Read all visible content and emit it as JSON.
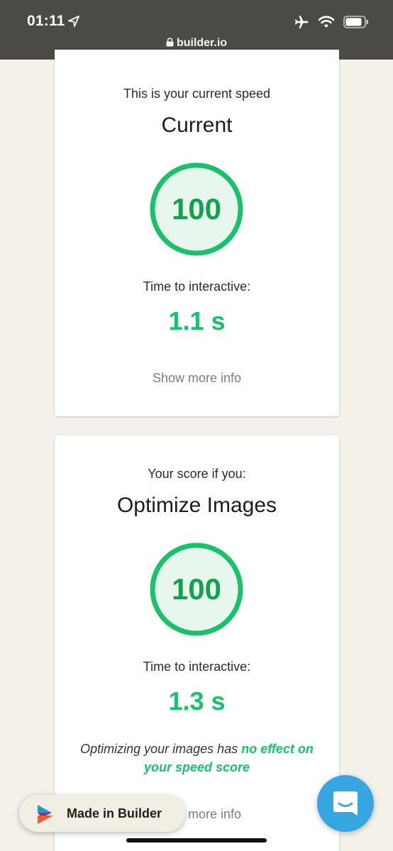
{
  "status_bar": {
    "time": "01:11",
    "url": "builder.io"
  },
  "colors": {
    "score_green": "#19c26a",
    "gauge_fill": "#e8f7ee",
    "chat_blue": "#36a6e0",
    "bar_bg": "#4b4a44"
  },
  "cards": [
    {
      "subtitle": "This is your current speed",
      "title": "Current",
      "score": "100",
      "score_fraction": 1.0,
      "tti_label": "Time to interactive:",
      "tti_value": "1.1 s",
      "more_info": "Show more info"
    },
    {
      "subtitle": "Your score if you:",
      "title": "Optimize Images",
      "score": "100",
      "score_fraction": 1.0,
      "tti_label": "Time to interactive:",
      "tti_value": "1.3 s",
      "note_prefix": "Optimizing your images has ",
      "note_highlight": "no effect on your speed score",
      "more_info": "Show more info"
    }
  ],
  "builder_badge": {
    "label": "Made in Builder",
    "icon": "builder-logo-icon"
  },
  "chat": {
    "icon": "chat-icon"
  }
}
